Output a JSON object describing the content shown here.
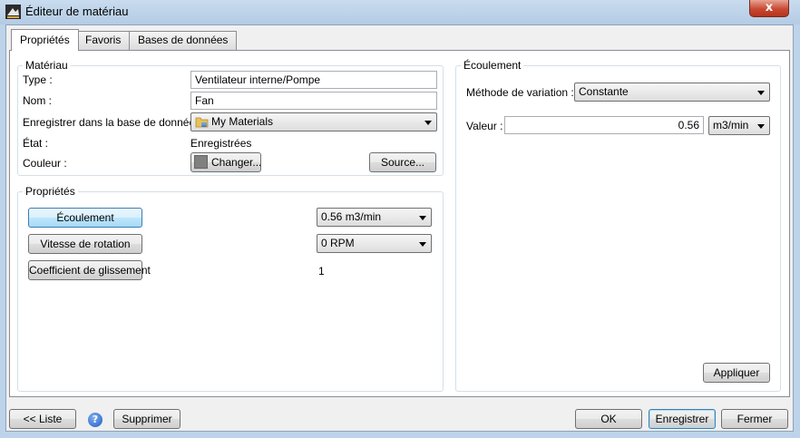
{
  "window": {
    "title": "Éditeur de matériau",
    "close_glyph": "x",
    "app_icon": "material-editor-icon"
  },
  "tabs": [
    {
      "label": "Propriétés",
      "active": true
    },
    {
      "label": "Favoris",
      "active": false
    },
    {
      "label": "Bases de données",
      "active": false
    }
  ],
  "materiau": {
    "legend": "Matériau",
    "type_label": "Type :",
    "type_value": "Ventilateur interne/Pompe",
    "nom_label": "Nom :",
    "nom_value": "Fan",
    "db_label": "Enregistrer dans la base de données :",
    "db_value": "My Materials",
    "db_icon": "database-folder-icon",
    "etat_label": "État :",
    "etat_value": "Enregistrées",
    "couleur_label": "Couleur :",
    "changer_label": "Changer...",
    "color_swatch": "#808080",
    "source_label": "Source..."
  },
  "proprietes": {
    "legend": "Propriétés",
    "rows": [
      {
        "button": "Écoulement",
        "value": "0.56 m3/min",
        "kind": "combo",
        "selected": true
      },
      {
        "button": "Vitesse de rotation",
        "value": "0 RPM",
        "kind": "combo",
        "selected": false
      },
      {
        "button": "Coefficient de glissement",
        "value": "1",
        "kind": "text",
        "selected": false
      }
    ]
  },
  "ecoulement": {
    "legend": "Écoulement",
    "methode_label": "Méthode de variation :",
    "methode_value": "Constante",
    "valeur_label": "Valeur :",
    "valeur_value": "0.56",
    "unit_value": "m3/min",
    "appliquer_label": "Appliquer"
  },
  "footer": {
    "liste_label": "<< Liste",
    "help_glyph": "?",
    "supprimer_label": "Supprimer",
    "ok_label": "OK",
    "enregistrer_label": "Enregistrer",
    "fermer_label": "Fermer"
  },
  "colors": {
    "selected_button": "#bee6fd",
    "frame": "#bcd3ea",
    "close_button": "#c84a34"
  }
}
